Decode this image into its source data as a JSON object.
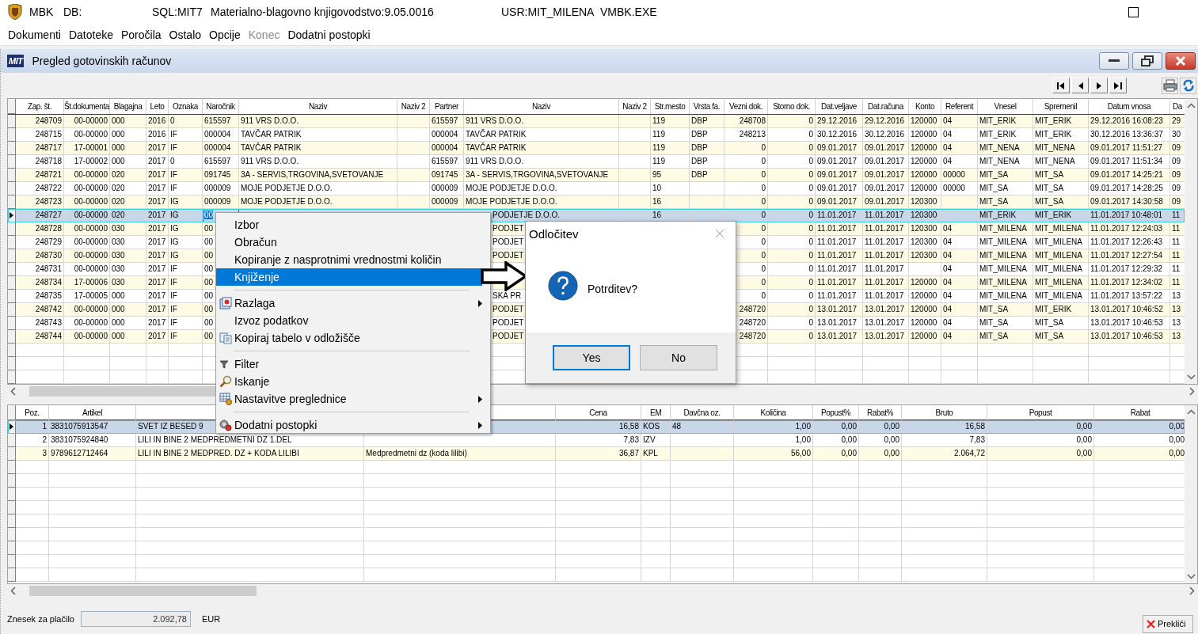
{
  "app_title_bar": {
    "app": "MBK",
    "db": "DB:",
    "server": "SQL:MIT7",
    "product": "Materialno-blagovno knjigovodstvo:9.05.0016",
    "user": "USR:MIT_MILENA",
    "exe": "VMBK.EXE"
  },
  "menu_bar": [
    {
      "label": "Dokumenti",
      "disabled": false
    },
    {
      "label": "Datoteke",
      "disabled": false
    },
    {
      "label": "Poročila",
      "disabled": false
    },
    {
      "label": "Ostalo",
      "disabled": false
    },
    {
      "label": "Opcije",
      "disabled": false
    },
    {
      "label": "Konec",
      "disabled": true
    },
    {
      "label": "Dodatni postopki",
      "disabled": false
    }
  ],
  "window": {
    "logo": "MIT",
    "title": "Pregled gotovinskih računov"
  },
  "documents_table": {
    "columns": [
      "Zap. št.",
      "Št.dokumenta",
      "Blagajna",
      "Leto",
      "Oznaka",
      "Naročnik",
      "Naziv",
      "Naziv 2",
      "Partner",
      "Naziv",
      "Naziv 2",
      "Str.mesto",
      "Vrsta fa.",
      "Vezni dok.",
      "Storno dok.",
      "Dat.veljave",
      "Dat.računa",
      "Konto",
      "Referent",
      "Vnesel",
      "Spremenil",
      "Datum vnosa",
      "Da"
    ],
    "rows": [
      {
        "kind": "full",
        "selected": false,
        "cells": [
          "248709",
          "00-00000",
          "000",
          "2016",
          "0",
          "615597",
          "911 VRS D.O.O.",
          null,
          "615597",
          "911 VRS D.O.O.",
          null,
          "119",
          "DBP",
          "248708",
          "0",
          "29.12.2016",
          "29.12.2016",
          "120000",
          "04",
          "MIT_ERIK",
          "MIT_ERIK",
          "29.12.2016 16:08:23",
          "29"
        ]
      },
      {
        "kind": "full",
        "selected": false,
        "cells": [
          "248715",
          "00-00000",
          "000",
          "2016",
          "IF",
          "000004",
          "TAVČAR PATRIK",
          null,
          "000004",
          "TAVČAR PATRIK",
          null,
          "119",
          "DBP",
          "248213",
          "0",
          "30.12.2016",
          "30.12.2016",
          "120000",
          "04",
          "MIT_ERIK",
          "MIT_ERIK",
          "30.12.2016 13:36:37",
          "30"
        ]
      },
      {
        "kind": "full",
        "selected": false,
        "cells": [
          "248717",
          "17-00001",
          "000",
          "2017",
          "IF",
          "000004",
          "TAVČAR PATRIK",
          null,
          "000004",
          "TAVČAR PATRIK",
          null,
          "119",
          "DBP",
          "0",
          "0",
          "09.01.2017",
          "09.01.2017",
          "120000",
          "04",
          "MIT_NENA",
          "MIT_NENA",
          "09.01.2017 11:51:27",
          "09"
        ]
      },
      {
        "kind": "full",
        "selected": false,
        "cells": [
          "248718",
          "17-00002",
          "000",
          "2017",
          "0",
          "615597",
          "911 VRS D.O.O.",
          null,
          "615597",
          "911 VRS D.O.O.",
          null,
          "119",
          "DBP",
          "0",
          "0",
          "09.01.2017",
          "09.01.2017",
          "120000",
          "04",
          "MIT_NENA",
          "MIT_NENA",
          "09.01.2017 11:51:34",
          "09"
        ]
      },
      {
        "kind": "full",
        "selected": false,
        "cells": [
          "248721",
          "00-00000",
          "020",
          "2017",
          "IF",
          "091745",
          "3A - SERVIS,TRGOVINA,SVETOVANJE",
          null,
          "091745",
          "3A - SERVIS,TRGOVINA,SVETOVANJE",
          null,
          "95",
          "DBP",
          "0",
          "0",
          "09.01.2017",
          "09.01.2017",
          "120000",
          "00000",
          "MIT_SA",
          "MIT_SA",
          "09.01.2017 14:25:21",
          "09"
        ]
      },
      {
        "kind": "full",
        "selected": false,
        "cells": [
          "248722",
          "00-00000",
          "020",
          "2017",
          "IF",
          "000009",
          "MOJE PODJETJE D.O.O.",
          null,
          "000009",
          "MOJE PODJETJE D.O.O.",
          null,
          "10",
          null,
          "0",
          "0",
          "09.01.2017",
          "09.01.2017",
          "120000",
          "00000",
          "MIT_SA",
          "MIT_SA",
          "09.01.2017 14:28:25",
          "09"
        ]
      },
      {
        "kind": "full",
        "selected": false,
        "cells": [
          "248723",
          "00-00000",
          "020",
          "2017",
          "IG",
          "000009",
          "MOJE PODJETJE D.O.O.",
          null,
          "000009",
          "MOJE PODJETJE D.O.O.",
          null,
          "16",
          null,
          "0",
          "0",
          "09.01.2017",
          "09.01.2017",
          "120300",
          null,
          "MIT_SA",
          "MIT_SA",
          "09.01.2017 14:30:58",
          "09"
        ]
      },
      {
        "kind": "covered",
        "selected": true,
        "cells": [
          "248727",
          "00-00000",
          "020",
          "2017",
          "IG",
          {
            "text": "00",
            "editing": true
          },
          null,
          null,
          null,
          "PODJETJE D.O.O.",
          null,
          "16",
          null,
          "0",
          "0",
          "11.01.2017",
          "11.01.2017",
          "120300",
          null,
          "MIT_ERIK",
          "MIT_ERIK",
          "11.01.2017 10:48:01",
          "11"
        ]
      },
      {
        "kind": "covered",
        "selected": false,
        "cells": [
          "248728",
          "00-00000",
          "030",
          "2017",
          "IG",
          "00",
          null,
          null,
          null,
          "PODJET",
          null,
          null,
          null,
          "0",
          "0",
          "11.01.2017",
          "11.01.2017",
          "120300",
          "04",
          "MIT_MILENA",
          "MIT_MILENA",
          "11.01.2017 12:24:03",
          "11"
        ]
      },
      {
        "kind": "covered",
        "selected": false,
        "cells": [
          "248729",
          "00-00000",
          "030",
          "2017",
          "IG",
          "00",
          null,
          null,
          null,
          "PODJET",
          null,
          null,
          null,
          "0",
          "0",
          "11.01.2017",
          "11.01.2017",
          "120300",
          "04",
          "MIT_MILENA",
          "MIT_MILENA",
          "11.01.2017 12:26:43",
          "11"
        ]
      },
      {
        "kind": "covered",
        "selected": false,
        "cells": [
          "248730",
          "00-00000",
          "030",
          "2017",
          "IG",
          "00",
          null,
          null,
          null,
          "PODJET",
          null,
          null,
          null,
          "0",
          "0",
          "11.01.2017",
          "11.01.2017",
          "120300",
          "04",
          "MIT_MILENA",
          "MIT_MILENA",
          "11.01.2017 12:27:54",
          "11"
        ]
      },
      {
        "kind": "covered",
        "selected": false,
        "cells": [
          "248731",
          "00-00000",
          "030",
          "2017",
          "IF",
          "00",
          null,
          null,
          null,
          null,
          null,
          null,
          null,
          "0",
          "0",
          "11.01.2017",
          "11.01.2017",
          null,
          "04",
          "MIT_MILENA",
          "MIT_MILENA",
          "11.01.2017 12:29:32",
          "11"
        ]
      },
      {
        "kind": "covered",
        "selected": false,
        "cells": [
          "248734",
          "17-00006",
          "030",
          "2017",
          "IF",
          "00",
          null,
          null,
          null,
          null,
          null,
          null,
          null,
          "0",
          "0",
          "11.01.2017",
          "11.01.2017",
          "120000",
          "04",
          "MIT_MILENA",
          "MIT_MILENA",
          "11.01.2017 12:34:02",
          "11"
        ]
      },
      {
        "kind": "covered",
        "selected": false,
        "cells": [
          "248735",
          "17-00005",
          "000",
          "2017",
          "IF",
          "00",
          null,
          null,
          null,
          "SKA PR",
          null,
          null,
          null,
          "0",
          "0",
          "11.01.2017",
          "11.01.2017",
          "120000",
          "04",
          "MIT_MILENA",
          "MIT_MILENA",
          "11.01.2017 13:57:22",
          "13"
        ]
      },
      {
        "kind": "covered",
        "selected": false,
        "cells": [
          "248742",
          "00-00000",
          "000",
          "2017",
          "IF",
          "00",
          null,
          null,
          null,
          "PODJET",
          null,
          null,
          null,
          "248720",
          "0",
          "13.01.2017",
          "13.01.2017",
          "120000",
          "04",
          "MIT_SA",
          "MIT_ERIK",
          "13.01.2017 10:46:52",
          "13"
        ]
      },
      {
        "kind": "covered",
        "selected": false,
        "cells": [
          "248743",
          "00-00000",
          "000",
          "2017",
          "IF",
          "00",
          null,
          null,
          null,
          "PODJET",
          null,
          null,
          null,
          "248720",
          "0",
          "13.01.2017",
          "13.01.2017",
          "120000",
          "04",
          "MIT_SA",
          "MIT_SA",
          "13.01.2017 10:46:53",
          "13"
        ]
      },
      {
        "kind": "covered",
        "selected": false,
        "cells": [
          "248744",
          "00-00000",
          "000",
          "2017",
          "IF",
          "00",
          null,
          null,
          null,
          "PODJET",
          null,
          null,
          null,
          "248720",
          "0",
          "13.01.2017",
          "13.01.2017",
          "120000",
          "04",
          "MIT_SA",
          "MIT_SA",
          "13.01.2017 10:46:53",
          "13"
        ]
      }
    ]
  },
  "items_table": {
    "columns": [
      "Poz.",
      "Artikel",
      null,
      null,
      "Cena",
      "EM",
      "Davčna oz.",
      "Količina",
      "Popust%",
      "Rabat%",
      "Bruto",
      "Popust",
      "Rabat"
    ],
    "rows": [
      {
        "selected": true,
        "cells": [
          "1",
          "3831075913547",
          "SVET IZ BESED 9",
          null,
          "16,58",
          "KOS",
          "48",
          "1,00",
          "0,00",
          "0,00",
          "16,58",
          "0,00",
          "0,00"
        ]
      },
      {
        "selected": false,
        "cells": [
          "2",
          "3831075924840",
          "LILI IN BINE 2 MEDPREDMETNI DZ 1.DEL",
          null,
          "7,83",
          "IZV",
          null,
          "1,00",
          "0,00",
          "0,00",
          "7,83",
          "0,00",
          "0,00"
        ]
      },
      {
        "selected": false,
        "cells": [
          "3",
          "9789612712464",
          "LILI IN BINE 2 MEDPRED. DZ + KODA LILIBI",
          "Medpredmetni dz (koda lilibi)",
          "36,87",
          "KPL",
          null,
          "56,00",
          "0,00",
          "0,00",
          "2.064,72",
          "0,00",
          "0,00"
        ]
      }
    ]
  },
  "context_menu": {
    "items": [
      {
        "kind": "item",
        "label": "Izbor",
        "selected": false,
        "submenu": false
      },
      {
        "kind": "item",
        "label": "Obračun",
        "selected": false,
        "submenu": false
      },
      {
        "kind": "item",
        "label": "Kopiranje z nasprotnimi vrednostmi količin",
        "selected": false,
        "submenu": false
      },
      {
        "kind": "item",
        "label": "Knjiženje",
        "selected": true,
        "submenu": false
      },
      {
        "kind": "separator"
      },
      {
        "kind": "item",
        "label": "Razlaga",
        "selected": false,
        "submenu": true
      },
      {
        "kind": "item",
        "label": "Izvoz podatkov",
        "selected": false,
        "submenu": false
      },
      {
        "kind": "item",
        "label": "Kopiraj tabelo v odložišče",
        "selected": false,
        "submenu": false
      },
      {
        "kind": "separator"
      },
      {
        "kind": "item",
        "label": "Filter",
        "selected": false,
        "submenu": false
      },
      {
        "kind": "item",
        "label": "Iskanje",
        "selected": false,
        "submenu": false
      },
      {
        "kind": "item",
        "label": "Nastavitve preglednice",
        "selected": false,
        "submenu": true
      },
      {
        "kind": "separator"
      },
      {
        "kind": "item",
        "label": "Dodatni postopki",
        "selected": false,
        "submenu": true
      }
    ]
  },
  "dialog": {
    "title": "Odločitev",
    "message": "Potrditev?",
    "buttons": [
      {
        "label": "Yes",
        "default": true
      },
      {
        "label": "No",
        "default": false
      }
    ]
  },
  "footer": {
    "label": "Znesek za plačilo",
    "amount": "2.092,78",
    "currency": "EUR",
    "cancel_button": "Prekliči"
  }
}
